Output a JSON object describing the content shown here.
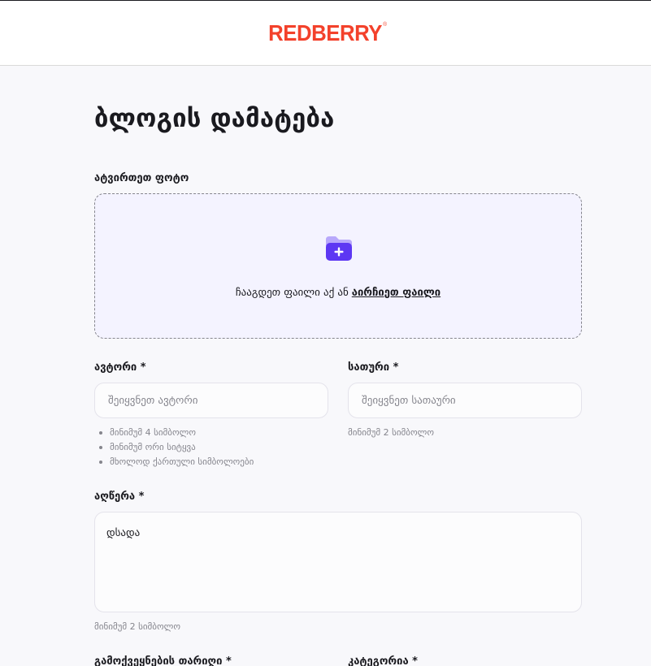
{
  "header": {
    "logo_text": "REDBERRY",
    "logo_mark": "®",
    "brand_color": "#F3412B"
  },
  "page": {
    "title": "ბლოგის დამატება"
  },
  "upload": {
    "label": "ატვირთეთ ფოტო",
    "icon": "folder-add-icon",
    "drop_text": "ჩააგდეთ ფაილი აქ ან",
    "browse_link": "აირჩიეთ ფაილი"
  },
  "author": {
    "label": "ავტორი *",
    "placeholder": "შეიყვნეთ ავტორი",
    "hints": [
      "მინიმუმ 4 სიმბოლო",
      "მინიმუმ ორი სიტყვა",
      "მხოლოდ ქართული სიმბოლოები"
    ]
  },
  "title_field": {
    "label": "სათური *",
    "placeholder": "შეიყვნეთ სათაური",
    "hint": "მინიმუმ 2 სიმბოლო"
  },
  "description": {
    "label": "აღწერა *",
    "value": "დსადა",
    "hint": "მინიმუმ 2 სიმბოლო"
  },
  "publish_date": {
    "label": "გამოქვეყნების თარიღი *"
  },
  "category": {
    "label": "კატეგორია *"
  },
  "colors": {
    "accent": "#5D37F3",
    "upload_bg": "#F4F3FF",
    "page_bg": "#F8F8FB"
  }
}
